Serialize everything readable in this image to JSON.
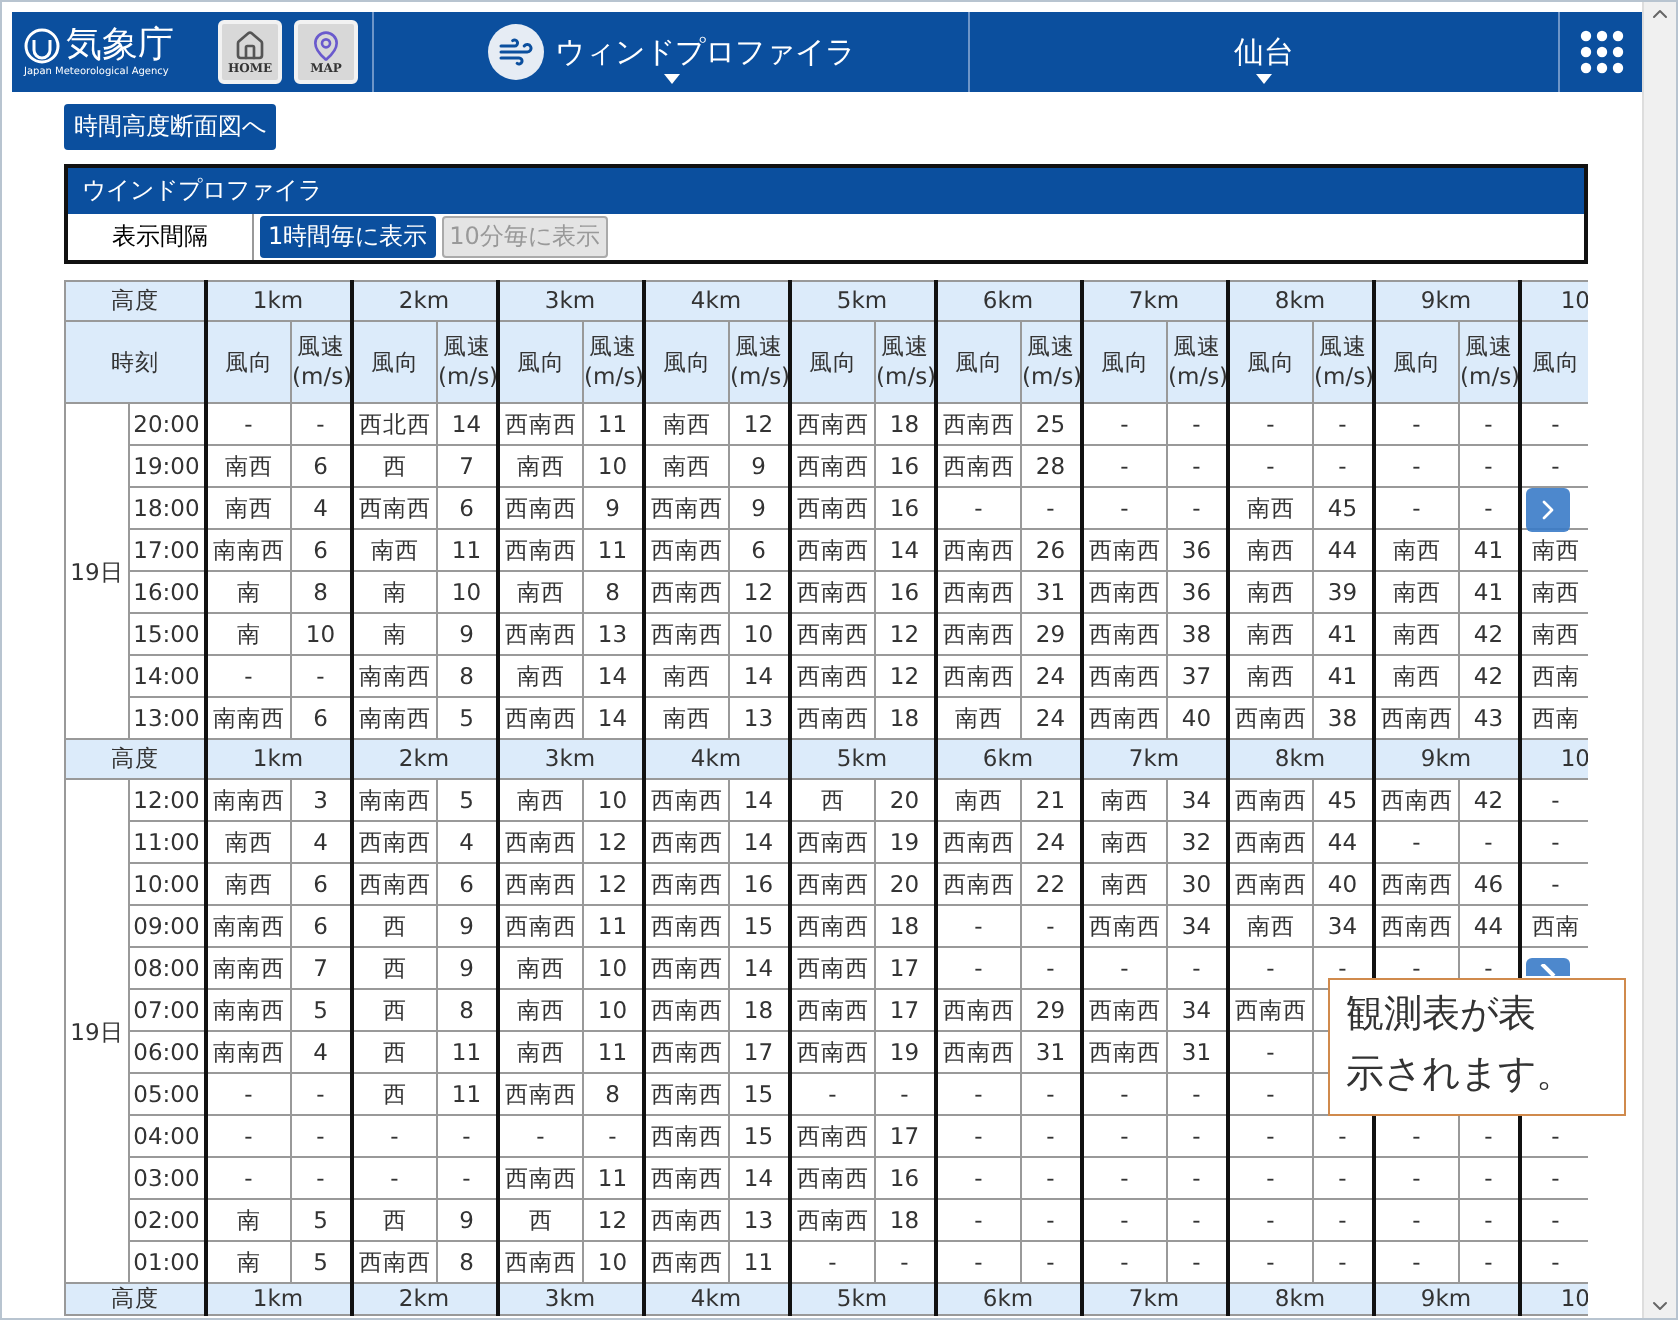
{
  "header": {
    "logo_title": "気象庁",
    "logo_subtitle": "Japan Meteorological Agency",
    "home_label": "HOME",
    "map_label": "MAP",
    "product_menu": "ウィンドプロファイラ",
    "station_menu": "仙台"
  },
  "section_link": "時間高度断面図へ",
  "panel": {
    "title": "ウインドプロファイラ",
    "interval_label": "表示間隔",
    "interval_options": [
      {
        "label": "1時間毎に表示",
        "selected": true
      },
      {
        "label": "10分毎に表示",
        "selected": false
      }
    ]
  },
  "table": {
    "blocks": [
      {
        "height_label": "高度",
        "heights": [
          "1km",
          "2km",
          "3km",
          "4km",
          "5km",
          "6km",
          "7km",
          "8km",
          "9km",
          "10"
        ],
        "time_label": "時刻",
        "subheaders": [
          "風向",
          "風速\n(m/s)",
          "風向",
          "風速\n(m/s)",
          "風向",
          "風速\n(m/s)",
          "風向",
          "風速\n(m/s)",
          "風向",
          "風速\n(m/s)",
          "風向",
          "風速\n(m/s)",
          "風向",
          "風速\n(m/s)",
          "風向",
          "風速\n(m/s)",
          "風向",
          "風速\n(m/s)",
          "風向"
        ],
        "date": "19日",
        "rows": [
          {
            "time": "20:00",
            "cells": [
              "-",
              "-",
              "西北西",
              "14",
              "西南西",
              "11",
              "南西",
              "12",
              "西南西",
              "18",
              "西南西",
              "25",
              "-",
              "-",
              "-",
              "-",
              "-",
              "-",
              "-"
            ]
          },
          {
            "time": "19:00",
            "cells": [
              "南西",
              "6",
              "西",
              "7",
              "南西",
              "10",
              "南西",
              "9",
              "西南西",
              "16",
              "西南西",
              "28",
              "-",
              "-",
              "-",
              "-",
              "-",
              "-",
              "-"
            ]
          },
          {
            "time": "18:00",
            "cells": [
              "南西",
              "4",
              "西南西",
              "6",
              "西南西",
              "9",
              "西南西",
              "9",
              "西南西",
              "16",
              "-",
              "-",
              "-",
              "-",
              "南西",
              "45",
              "-",
              "-",
              null
            ]
          },
          {
            "time": "17:00",
            "cells": [
              "南南西",
              "6",
              "南西",
              "11",
              "西南西",
              "11",
              "西南西",
              "6",
              "西南西",
              "14",
              "西南西",
              "26",
              "西南西",
              "36",
              "南西",
              "44",
              "南西",
              "41",
              "南西"
            ]
          },
          {
            "time": "16:00",
            "cells": [
              "南",
              "8",
              "南",
              "10",
              "南西",
              "8",
              "西南西",
              "12",
              "西南西",
              "16",
              "西南西",
              "31",
              "西南西",
              "36",
              "南西",
              "39",
              "南西",
              "41",
              "南西"
            ]
          },
          {
            "time": "15:00",
            "cells": [
              "南",
              "10",
              "南",
              "9",
              "西南西",
              "13",
              "西南西",
              "10",
              "西南西",
              "12",
              "西南西",
              "29",
              "西南西",
              "38",
              "南西",
              "41",
              "南西",
              "42",
              "南西"
            ]
          },
          {
            "time": "14:00",
            "cells": [
              "-",
              "-",
              "南南西",
              "8",
              "南西",
              "14",
              "南西",
              "14",
              "西南西",
              "12",
              "西南西",
              "24",
              "西南西",
              "37",
              "南西",
              "41",
              "南西",
              "42",
              "西南"
            ]
          },
          {
            "time": "13:00",
            "cells": [
              "南南西",
              "6",
              "南南西",
              "5",
              "西南西",
              "14",
              "南西",
              "13",
              "西南西",
              "18",
              "南西",
              "24",
              "西南西",
              "40",
              "西南西",
              "38",
              "西南西",
              "43",
              "西南"
            ]
          }
        ]
      },
      {
        "height_label": "高度",
        "heights": [
          "1km",
          "2km",
          "3km",
          "4km",
          "5km",
          "6km",
          "7km",
          "8km",
          "9km",
          "10"
        ],
        "date": "19日",
        "rows": [
          {
            "time": "12:00",
            "cells": [
              "南南西",
              "3",
              "南南西",
              "5",
              "南西",
              "10",
              "西南西",
              "14",
              "西",
              "20",
              "南西",
              "21",
              "南西",
              "34",
              "西南西",
              "45",
              "西南西",
              "42",
              "-"
            ]
          },
          {
            "time": "11:00",
            "cells": [
              "南西",
              "4",
              "西南西",
              "4",
              "西南西",
              "12",
              "西南西",
              "14",
              "西南西",
              "19",
              "西南西",
              "24",
              "南西",
              "32",
              "西南西",
              "44",
              "-",
              "-",
              "-"
            ]
          },
          {
            "time": "10:00",
            "cells": [
              "南西",
              "6",
              "西南西",
              "6",
              "西南西",
              "12",
              "西南西",
              "16",
              "西南西",
              "20",
              "西南西",
              "22",
              "南西",
              "30",
              "西南西",
              "40",
              "西南西",
              "46",
              "-"
            ]
          },
          {
            "time": "09:00",
            "cells": [
              "南南西",
              "6",
              "西",
              "9",
              "西南西",
              "11",
              "西南西",
              "15",
              "西南西",
              "18",
              "-",
              "-",
              "西南西",
              "34",
              "南西",
              "34",
              "西南西",
              "44",
              "西南"
            ]
          },
          {
            "time": "08:00",
            "cells": [
              "南南西",
              "7",
              "西",
              "9",
              "南西",
              "10",
              "西南西",
              "14",
              "西南西",
              "17",
              "-",
              "-",
              "-",
              "-",
              "-",
              "-",
              "-",
              "-",
              null
            ]
          },
          {
            "time": "07:00",
            "cells": [
              "南南西",
              "5",
              "西",
              "8",
              "南西",
              "10",
              "西南西",
              "18",
              "西南西",
              "17",
              "西南西",
              "29",
              "西南西",
              "34",
              "西南西",
              null,
              null,
              null,
              null
            ]
          },
          {
            "time": "06:00",
            "cells": [
              "南南西",
              "4",
              "西",
              "11",
              "南西",
              "11",
              "西南西",
              "17",
              "西南西",
              "19",
              "西南西",
              "31",
              "西南西",
              "31",
              "-",
              null,
              null,
              null,
              null
            ]
          },
          {
            "time": "05:00",
            "cells": [
              "-",
              "-",
              "西",
              "11",
              "西南西",
              "8",
              "西南西",
              "15",
              "-",
              "-",
              "-",
              "-",
              "-",
              "-",
              "-",
              null,
              null,
              null,
              null
            ]
          },
          {
            "time": "04:00",
            "cells": [
              "-",
              "-",
              "-",
              "-",
              "-",
              "-",
              "西南西",
              "15",
              "西南西",
              "17",
              "-",
              "-",
              "-",
              "-",
              "-",
              "-",
              "-",
              "-",
              "-"
            ]
          },
          {
            "time": "03:00",
            "cells": [
              "-",
              "-",
              "-",
              "-",
              "西南西",
              "11",
              "西南西",
              "14",
              "西南西",
              "16",
              "-",
              "-",
              "-",
              "-",
              "-",
              "-",
              "-",
              "-",
              "-"
            ]
          },
          {
            "time": "02:00",
            "cells": [
              "南",
              "5",
              "西",
              "9",
              "西",
              "12",
              "西南西",
              "13",
              "西南西",
              "18",
              "-",
              "-",
              "-",
              "-",
              "-",
              "-",
              "-",
              "-",
              "-"
            ]
          },
          {
            "time": "01:00",
            "cells": [
              "南",
              "5",
              "西南西",
              "8",
              "西南西",
              "10",
              "西南西",
              "11",
              "-",
              "-",
              "-",
              "-",
              "-",
              "-",
              "-",
              "-",
              "-",
              "-",
              "-"
            ]
          }
        ]
      },
      {
        "height_label": "高度",
        "heights": [
          "1km",
          "2km",
          "3km",
          "4km",
          "5km",
          "6km",
          "7km",
          "8km",
          "9km",
          "10"
        ]
      }
    ]
  },
  "callout": {
    "lines": [
      "観測表が表",
      "示されます。"
    ]
  }
}
